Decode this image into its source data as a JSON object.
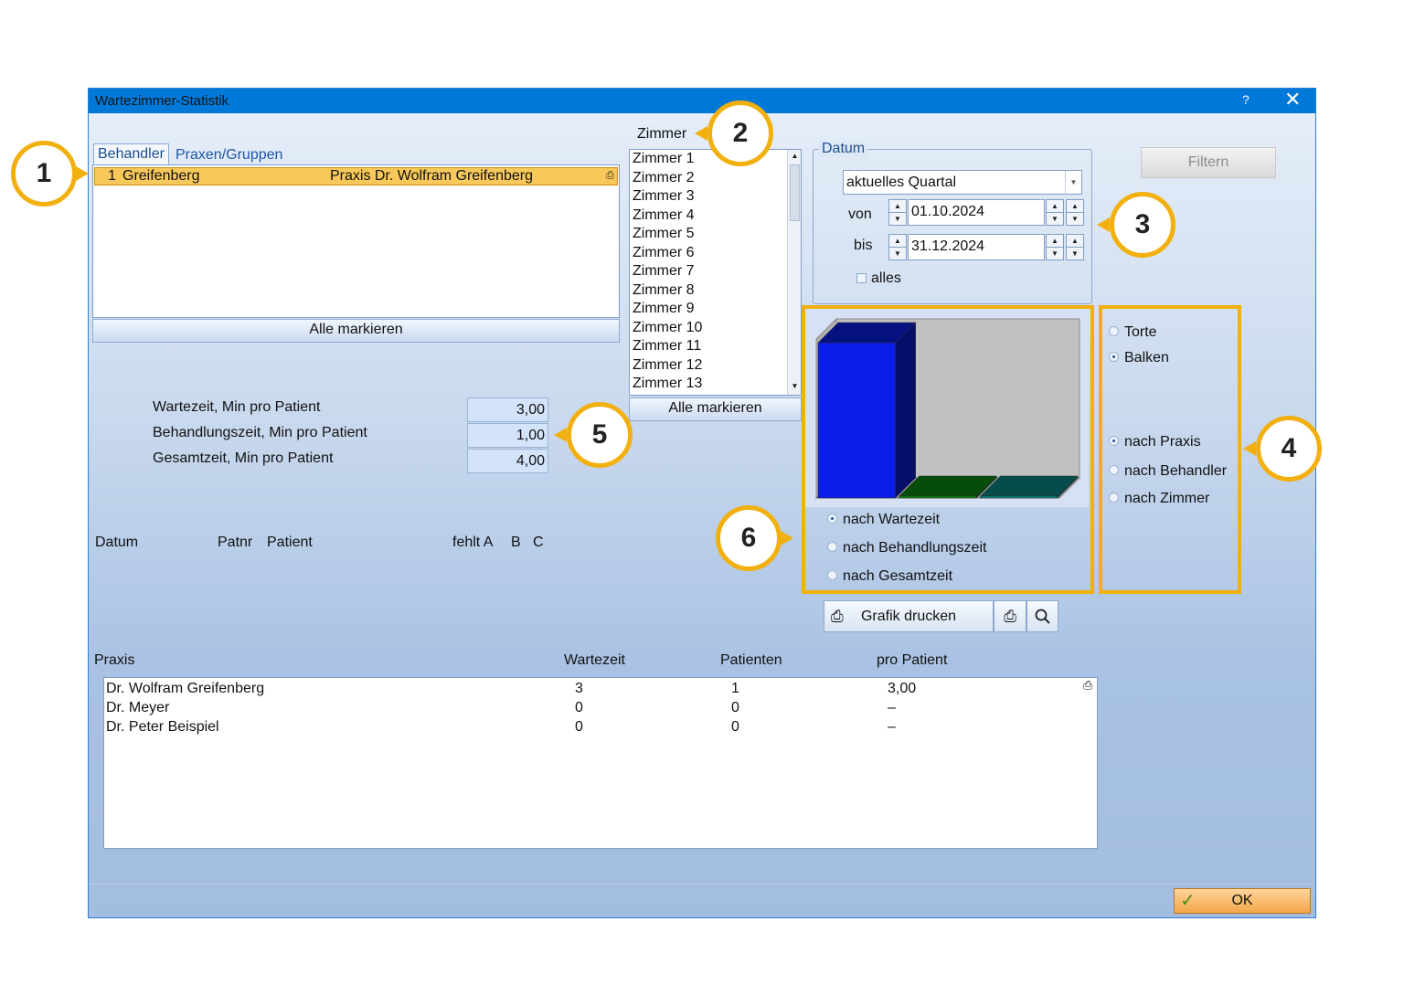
{
  "window": {
    "title": "Wartezimmer-Statistik",
    "help": "?",
    "close": "✕"
  },
  "tabs": [
    {
      "label": "Behandler"
    },
    {
      "label": "Praxen/Gruppen"
    }
  ],
  "behandler_list": {
    "rows": [
      {
        "id": "1",
        "name": "Greifenberg",
        "praxis": "Praxis Dr. Wolfram Greifenberg"
      }
    ],
    "mark_all": "Alle markieren"
  },
  "zimmer": {
    "label": "Zimmer",
    "items": [
      "Zimmer 1",
      "Zimmer 2",
      "Zimmer 3",
      "Zimmer 4",
      "Zimmer 5",
      "Zimmer 6",
      "Zimmer 7",
      "Zimmer 8",
      "Zimmer 9",
      "Zimmer 10",
      "Zimmer 11",
      "Zimmer 12",
      "Zimmer 13"
    ],
    "mark_all": "Alle markieren"
  },
  "datum": {
    "group_label": "Datum",
    "range_select": "aktuelles Quartal",
    "von_label": "von",
    "von": "01.10.2024",
    "bis_label": "bis",
    "bis": "31.12.2024",
    "alles_label": "alles"
  },
  "filter_button": "Filtern",
  "stats": [
    {
      "label": "Wartezeit, Min pro Patient",
      "value": "3,00"
    },
    {
      "label": "Behandlungszeit, Min pro Patient",
      "value": "1,00"
    },
    {
      "label": "Gesamtzeit, Min pro Patient",
      "value": "4,00"
    }
  ],
  "chart_type_options": [
    {
      "label": "Torte",
      "selected": false
    },
    {
      "label": "Balken",
      "selected": true
    }
  ],
  "group_options": [
    {
      "label": "nach Praxis",
      "selected": true
    },
    {
      "label": "nach Behandler",
      "selected": false
    },
    {
      "label": "nach Zimmer",
      "selected": false
    }
  ],
  "metric_options": [
    {
      "label": "nach Wartezeit",
      "selected": true
    },
    {
      "label": "nach Behandlungszeit",
      "selected": false
    },
    {
      "label": "nach Gesamtzeit",
      "selected": false
    }
  ],
  "chart_data": {
    "type": "bar",
    "categories": [
      "Dr. Wolfram Greifenberg",
      "Dr. Meyer",
      "Dr. Peter Beispiel"
    ],
    "values": [
      3,
      0,
      0
    ],
    "colors": [
      "#0a1ee8",
      "#0b8a12",
      "#0b8a88"
    ],
    "title": "",
    "xlabel": "",
    "ylabel": ""
  },
  "print_button": "Grafik drucken",
  "detail_headers": {
    "datum": "Datum",
    "patnr": "Patnr",
    "patient": "Patient",
    "fehlt": "fehlt A",
    "b": "B",
    "c": "C"
  },
  "summary": {
    "headers": {
      "praxis": "Praxis",
      "wartezeit": "Wartezeit",
      "patienten": "Patienten",
      "pro_patient": "pro Patient"
    },
    "rows": [
      {
        "praxis": "Dr. Wolfram Greifenberg",
        "wartezeit": "3",
        "patienten": "1",
        "pro_patient": "3,00"
      },
      {
        "praxis": "Dr. Meyer",
        "wartezeit": "0",
        "patienten": "0",
        "pro_patient": "–"
      },
      {
        "praxis": "Dr. Peter Beispiel",
        "wartezeit": "0",
        "patienten": "0",
        "pro_patient": "–"
      }
    ]
  },
  "ok_button": "OK",
  "callouts": [
    "1",
    "2",
    "3",
    "4",
    "5",
    "6"
  ],
  "highlight_color": "#f2b00f",
  "selection_color": "#f8c95a"
}
